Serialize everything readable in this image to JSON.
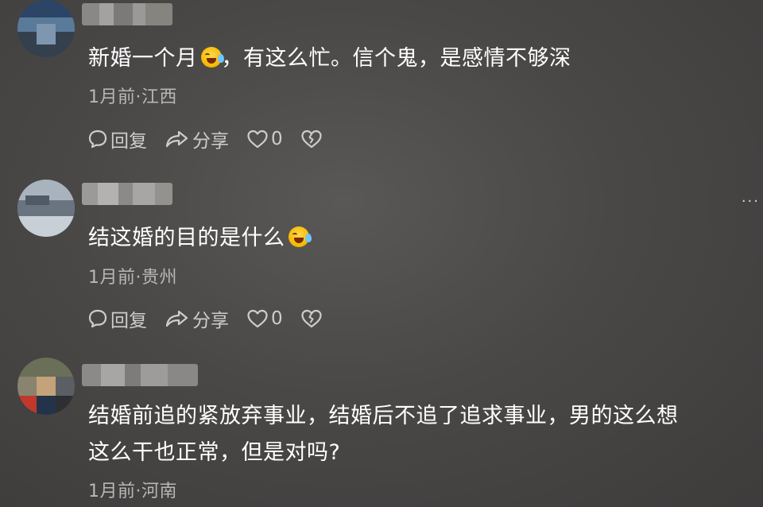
{
  "comments": [
    {
      "text": "新婚一个月",
      "text_after_emoji": "，有这么忙。信个鬼，是感情不够深",
      "meta": "1月前·江西",
      "reply_label": "回复",
      "share_label": "分享",
      "like_count": "0"
    },
    {
      "text": "结这婚的目的是什么",
      "meta": "1月前·贵州",
      "reply_label": "回复",
      "share_label": "分享",
      "like_count": "0"
    },
    {
      "text_line1": "结婚前追的紧放弃事业，结婚后不追了追求事业，男的这么想",
      "text_line2": "这么干也正常，但是对吗?",
      "meta": "1月前·河南"
    }
  ],
  "more_label": "···",
  "icons": {
    "reply": "comment-bubble-icon",
    "share": "share-arrow-icon",
    "like": "heart-icon",
    "dislike": "broken-heart-icon",
    "emoji": "crying-laughing-emoji-icon",
    "more": "more-dots-icon"
  },
  "colors": {
    "background": "#4a4847",
    "text": "#ffffff",
    "meta": "#b9b7b4",
    "action": "#cfcdca",
    "emoji": "#f5b800"
  }
}
